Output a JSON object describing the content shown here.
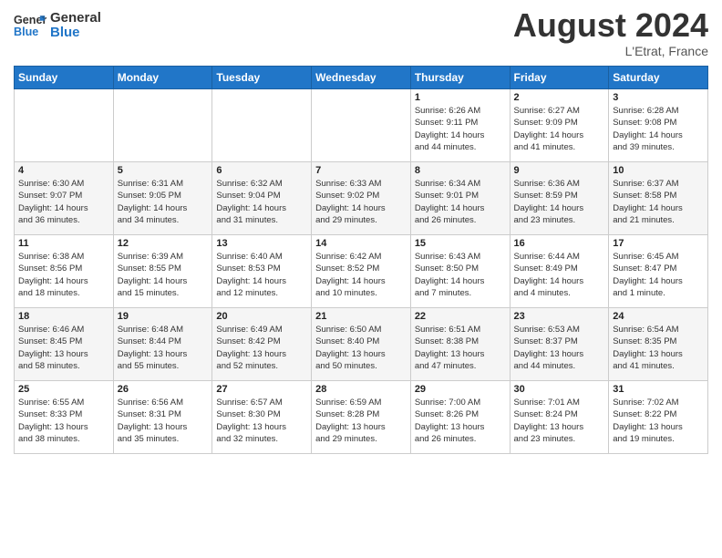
{
  "header": {
    "logo_line1": "General",
    "logo_line2": "Blue",
    "month_year": "August 2024",
    "location": "L'Etrat, France"
  },
  "weekdays": [
    "Sunday",
    "Monday",
    "Tuesday",
    "Wednesday",
    "Thursday",
    "Friday",
    "Saturday"
  ],
  "weeks": [
    [
      {
        "day": "",
        "info": ""
      },
      {
        "day": "",
        "info": ""
      },
      {
        "day": "",
        "info": ""
      },
      {
        "day": "",
        "info": ""
      },
      {
        "day": "1",
        "info": "Sunrise: 6:26 AM\nSunset: 9:11 PM\nDaylight: 14 hours\nand 44 minutes."
      },
      {
        "day": "2",
        "info": "Sunrise: 6:27 AM\nSunset: 9:09 PM\nDaylight: 14 hours\nand 41 minutes."
      },
      {
        "day": "3",
        "info": "Sunrise: 6:28 AM\nSunset: 9:08 PM\nDaylight: 14 hours\nand 39 minutes."
      }
    ],
    [
      {
        "day": "4",
        "info": "Sunrise: 6:30 AM\nSunset: 9:07 PM\nDaylight: 14 hours\nand 36 minutes."
      },
      {
        "day": "5",
        "info": "Sunrise: 6:31 AM\nSunset: 9:05 PM\nDaylight: 14 hours\nand 34 minutes."
      },
      {
        "day": "6",
        "info": "Sunrise: 6:32 AM\nSunset: 9:04 PM\nDaylight: 14 hours\nand 31 minutes."
      },
      {
        "day": "7",
        "info": "Sunrise: 6:33 AM\nSunset: 9:02 PM\nDaylight: 14 hours\nand 29 minutes."
      },
      {
        "day": "8",
        "info": "Sunrise: 6:34 AM\nSunset: 9:01 PM\nDaylight: 14 hours\nand 26 minutes."
      },
      {
        "day": "9",
        "info": "Sunrise: 6:36 AM\nSunset: 8:59 PM\nDaylight: 14 hours\nand 23 minutes."
      },
      {
        "day": "10",
        "info": "Sunrise: 6:37 AM\nSunset: 8:58 PM\nDaylight: 14 hours\nand 21 minutes."
      }
    ],
    [
      {
        "day": "11",
        "info": "Sunrise: 6:38 AM\nSunset: 8:56 PM\nDaylight: 14 hours\nand 18 minutes."
      },
      {
        "day": "12",
        "info": "Sunrise: 6:39 AM\nSunset: 8:55 PM\nDaylight: 14 hours\nand 15 minutes."
      },
      {
        "day": "13",
        "info": "Sunrise: 6:40 AM\nSunset: 8:53 PM\nDaylight: 14 hours\nand 12 minutes."
      },
      {
        "day": "14",
        "info": "Sunrise: 6:42 AM\nSunset: 8:52 PM\nDaylight: 14 hours\nand 10 minutes."
      },
      {
        "day": "15",
        "info": "Sunrise: 6:43 AM\nSunset: 8:50 PM\nDaylight: 14 hours\nand 7 minutes."
      },
      {
        "day": "16",
        "info": "Sunrise: 6:44 AM\nSunset: 8:49 PM\nDaylight: 14 hours\nand 4 minutes."
      },
      {
        "day": "17",
        "info": "Sunrise: 6:45 AM\nSunset: 8:47 PM\nDaylight: 14 hours\nand 1 minute."
      }
    ],
    [
      {
        "day": "18",
        "info": "Sunrise: 6:46 AM\nSunset: 8:45 PM\nDaylight: 13 hours\nand 58 minutes."
      },
      {
        "day": "19",
        "info": "Sunrise: 6:48 AM\nSunset: 8:44 PM\nDaylight: 13 hours\nand 55 minutes."
      },
      {
        "day": "20",
        "info": "Sunrise: 6:49 AM\nSunset: 8:42 PM\nDaylight: 13 hours\nand 52 minutes."
      },
      {
        "day": "21",
        "info": "Sunrise: 6:50 AM\nSunset: 8:40 PM\nDaylight: 13 hours\nand 50 minutes."
      },
      {
        "day": "22",
        "info": "Sunrise: 6:51 AM\nSunset: 8:38 PM\nDaylight: 13 hours\nand 47 minutes."
      },
      {
        "day": "23",
        "info": "Sunrise: 6:53 AM\nSunset: 8:37 PM\nDaylight: 13 hours\nand 44 minutes."
      },
      {
        "day": "24",
        "info": "Sunrise: 6:54 AM\nSunset: 8:35 PM\nDaylight: 13 hours\nand 41 minutes."
      }
    ],
    [
      {
        "day": "25",
        "info": "Sunrise: 6:55 AM\nSunset: 8:33 PM\nDaylight: 13 hours\nand 38 minutes."
      },
      {
        "day": "26",
        "info": "Sunrise: 6:56 AM\nSunset: 8:31 PM\nDaylight: 13 hours\nand 35 minutes."
      },
      {
        "day": "27",
        "info": "Sunrise: 6:57 AM\nSunset: 8:30 PM\nDaylight: 13 hours\nand 32 minutes."
      },
      {
        "day": "28",
        "info": "Sunrise: 6:59 AM\nSunset: 8:28 PM\nDaylight: 13 hours\nand 29 minutes."
      },
      {
        "day": "29",
        "info": "Sunrise: 7:00 AM\nSunset: 8:26 PM\nDaylight: 13 hours\nand 26 minutes."
      },
      {
        "day": "30",
        "info": "Sunrise: 7:01 AM\nSunset: 8:24 PM\nDaylight: 13 hours\nand 23 minutes."
      },
      {
        "day": "31",
        "info": "Sunrise: 7:02 AM\nSunset: 8:22 PM\nDaylight: 13 hours\nand 19 minutes."
      }
    ]
  ]
}
